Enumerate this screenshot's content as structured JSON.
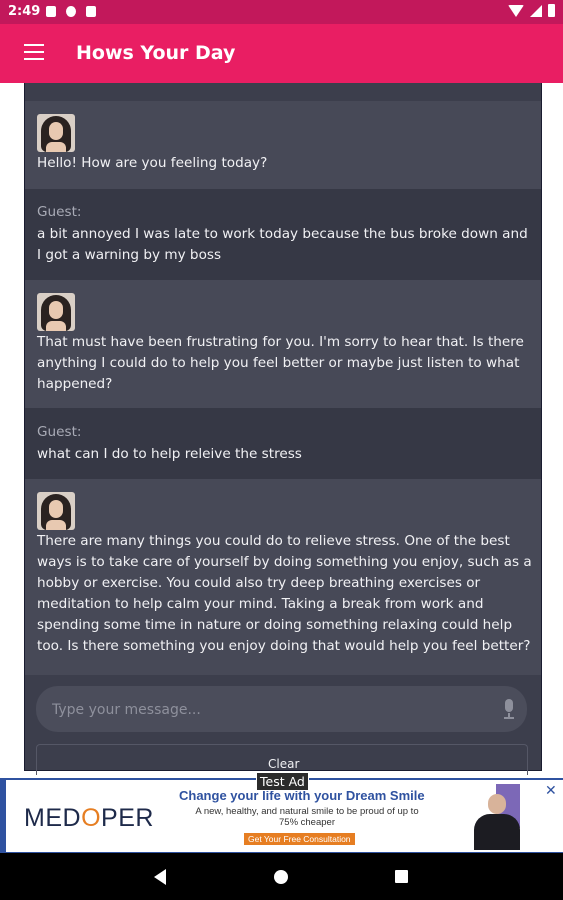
{
  "status_bar": {
    "time": "2:49"
  },
  "app_bar": {
    "title": "Hows Your Day"
  },
  "messages": [
    {
      "role": "bot",
      "text": "Hello! How are you feeling today?"
    },
    {
      "role": "user",
      "sender": "Guest:",
      "text": "a bit annoyed I was late to work today because the bus broke down and I got a warning by my boss"
    },
    {
      "role": "bot",
      "text": "That must have been frustrating for you. I'm sorry to hear that. Is there anything I could do to help you feel better or maybe just listen to what happened?"
    },
    {
      "role": "user",
      "sender": "Guest:",
      "text": "what can I do to help releive the stress"
    },
    {
      "role": "bot",
      "text": "There are many things you could do to relieve stress. One of the best ways is to take care of yourself by doing something you enjoy, such as a hobby or exercise. You could also try deep breathing exercises or meditation to help calm your mind. Taking a break from work and spending some time in nature or doing something relaxing could help too. Is there something you enjoy doing that would help you feel better?"
    }
  ],
  "composer": {
    "placeholder": "Type your message...",
    "value": ""
  },
  "clear_label": "Clear",
  "test_ad_label": "Test Ad",
  "ad": {
    "logo_prefix": "MED",
    "logo_o": "O",
    "logo_suffix": "PER",
    "headline": "Change your life with your Dream Smile",
    "sub": "A new, healthy, and natural smile to be proud of up to 75% cheaper",
    "cta": "Get Your Free Consultation",
    "close": "✕"
  },
  "icons": {
    "menu": "menu-icon",
    "mic": "mic-icon",
    "wifi": "wifi-icon",
    "signal": "signal-icon",
    "battery": "battery-icon"
  },
  "colors": {
    "app_bar": "#e91e63",
    "status_bar": "#c2185b",
    "chat_bg": "#3c3e4c",
    "bot_bg": "#474957",
    "user_bg": "#363845"
  }
}
